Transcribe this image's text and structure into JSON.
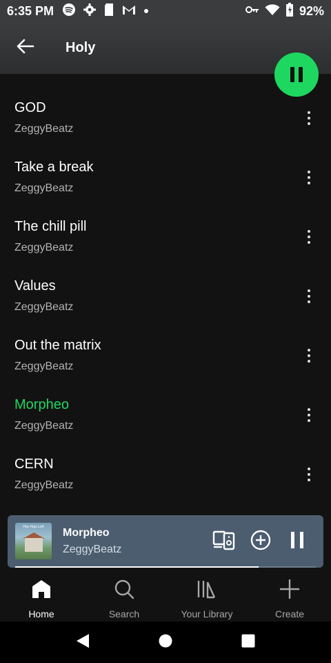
{
  "status_bar": {
    "time": "6:35 PM",
    "battery": "92%",
    "icons_left": [
      "spotify-icon",
      "gear-icon",
      "sd-card-icon",
      "gmail-icon",
      "dot-icon"
    ],
    "icons_right": [
      "vpn-key-icon",
      "wifi-icon",
      "battery-icon"
    ]
  },
  "header": {
    "title": "Holy"
  },
  "tracks": [
    {
      "title": "GOD",
      "artist": "ZeggyBeatz",
      "playing": false
    },
    {
      "title": "Take a break",
      "artist": "ZeggyBeatz",
      "playing": false
    },
    {
      "title": "The chill pill",
      "artist": "ZeggyBeatz",
      "playing": false
    },
    {
      "title": "Values",
      "artist": "ZeggyBeatz",
      "playing": false
    },
    {
      "title": "Out the matrix",
      "artist": "ZeggyBeatz",
      "playing": false
    },
    {
      "title": "Morpheo",
      "artist": "ZeggyBeatz",
      "playing": true
    },
    {
      "title": "CERN",
      "artist": "ZeggyBeatz",
      "playing": false
    }
  ],
  "mini_player": {
    "title": "Morpheo",
    "artist": "ZeggyBeatz",
    "art_text": "Hip-Hop Lofi",
    "progress": 0.81
  },
  "bottom_nav": [
    {
      "label": "Home",
      "icon": "home-icon",
      "active": true
    },
    {
      "label": "Search",
      "icon": "search-icon",
      "active": false
    },
    {
      "label": "Your Library",
      "icon": "library-icon",
      "active": false
    },
    {
      "label": "Create",
      "icon": "plus-icon",
      "active": false
    }
  ],
  "colors": {
    "accent": "#1ed760",
    "background": "#121212",
    "mini_player_bg": "#4b5d6f"
  }
}
